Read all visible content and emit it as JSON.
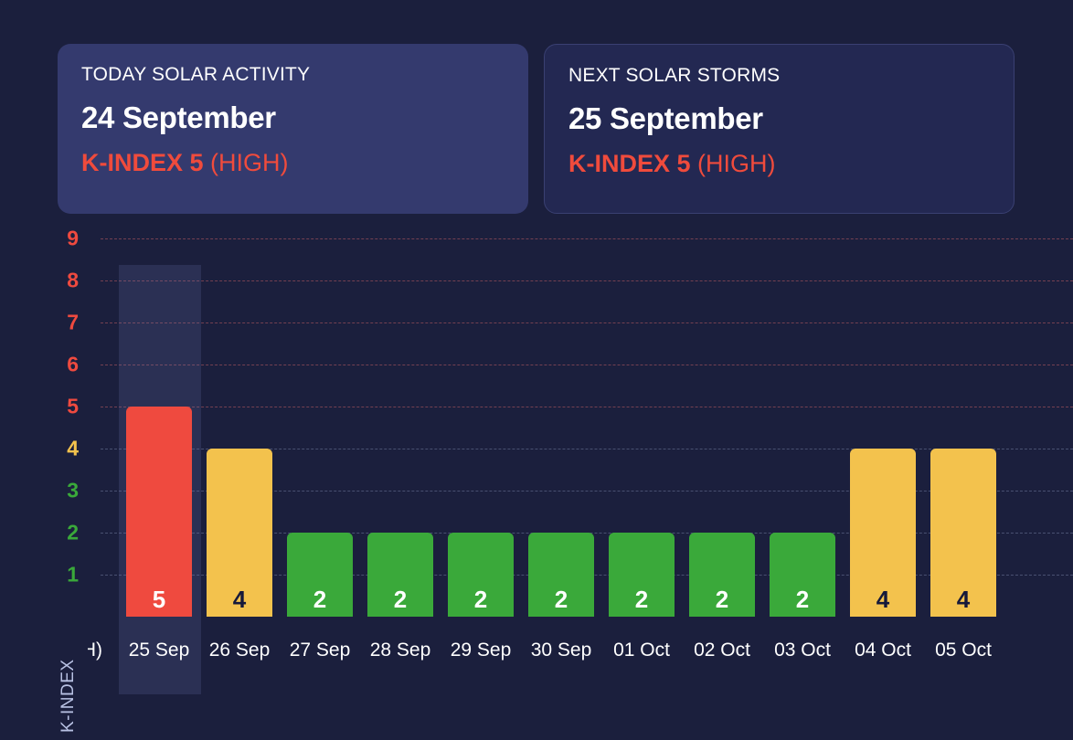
{
  "cards": [
    {
      "label": "TODAY SOLAR ACTIVITY",
      "date": "24 September",
      "kindex_strong": "K-INDEX 5",
      "kindex_level": " (HIGH)",
      "style": "today",
      "accent": "#f04b3c",
      "background": "#343a6e"
    },
    {
      "label": "NEXT SOLAR STORMS",
      "date": "25 September",
      "kindex_strong": "K-INDEX 5",
      "kindex_level": " (HIGH)",
      "style": "next",
      "accent": "#f04b3c",
      "background": "#232852"
    }
  ],
  "chart_data": {
    "type": "bar",
    "title": "",
    "xlabel": "",
    "ylabel": "K-INDEX",
    "ylim": [
      0,
      9.6
    ],
    "grid": true,
    "legend": false,
    "y_ticks": [
      {
        "label": "9",
        "value": 9,
        "color": "#ef4a3f"
      },
      {
        "label": "8",
        "value": 8,
        "color": "#ef4a3f"
      },
      {
        "label": "7",
        "value": 7,
        "color": "#ef4a3f"
      },
      {
        "label": "6",
        "value": 6,
        "color": "#ef4a3f"
      },
      {
        "label": "5",
        "value": 5,
        "color": "#ef4a3f"
      },
      {
        "label": "4",
        "value": 4,
        "color": "#f3c24d"
      },
      {
        "label": "3",
        "value": 3,
        "color": "#3aa93a"
      },
      {
        "label": "2",
        "value": 2,
        "color": "#3aa93a"
      },
      {
        "label": "1",
        "value": 1,
        "color": "#3aa93a"
      }
    ],
    "categories": [
      "25 Sep",
      "26 Sep",
      "27 Sep",
      "28 Sep",
      "29 Sep",
      "30 Sep",
      "01 Oct",
      "02 Oct",
      "03 Oct",
      "04 Oct",
      "05 Oct"
    ],
    "values": [
      5,
      4,
      2,
      2,
      2,
      2,
      2,
      2,
      2,
      4,
      4
    ],
    "bar_colors": [
      "#ef4a3f",
      "#f3c24d",
      "#3aa93a",
      "#3aa93a",
      "#3aa93a",
      "#3aa93a",
      "#3aa93a",
      "#3aa93a",
      "#3aa93a",
      "#f3c24d",
      "#f3c24d"
    ],
    "bar_label_colors": [
      "#ffffff",
      "#16193a",
      "#ffffff",
      "#ffffff",
      "#ffffff",
      "#ffffff",
      "#ffffff",
      "#ffffff",
      "#ffffff",
      "#16193a",
      "#16193a"
    ],
    "highlighted_category": "25 Sep",
    "clipped_left_label": "(HIGH)"
  },
  "colors": {
    "page_background": "#1b1f3d",
    "grid_warm": "rgba(240,110,110,0.42)",
    "grid_cool": "rgba(170,185,225,0.32)",
    "highlight": "rgba(118,128,190,0.18)",
    "axis_title": "#b9c2e4"
  }
}
